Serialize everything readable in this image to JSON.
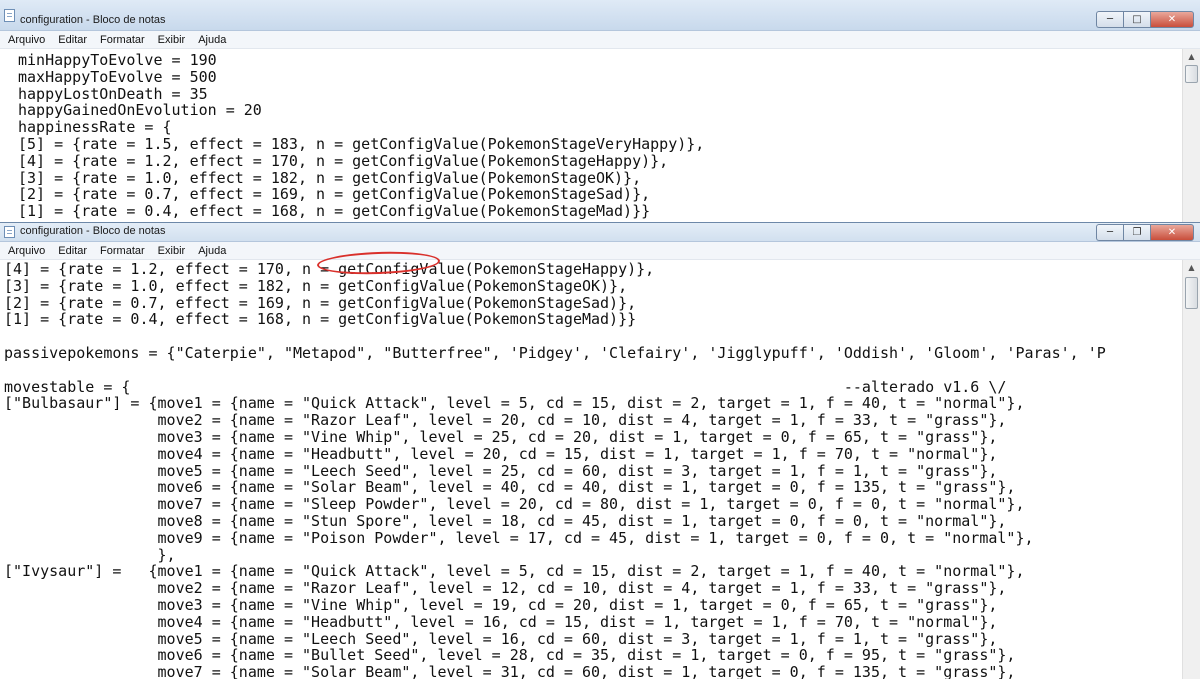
{
  "window_top": {
    "title": "configuration - Bloco de notas",
    "menu": [
      "Arquivo",
      "Editar",
      "Formatar",
      "Exibir",
      "Ajuda"
    ],
    "content": "minHappyToEvolve = 190\nmaxHappyToEvolve = 500\nhappyLostOnDeath = 35\nhappyGainedOnEvolution = 20\nhappinessRate = {\n[5] = {rate = 1.5, effect = 183, n = getConfigValue(PokemonStageVeryHappy)},\n[4] = {rate = 1.2, effect = 170, n = getConfigValue(PokemonStageHappy)},\n[3] = {rate = 1.0, effect = 182, n = getConfigValue(PokemonStageOK)},\n[2] = {rate = 0.7, effect = 169, n = getConfigValue(PokemonStageSad)},\n[1] = {rate = 0.4, effect = 168, n = getConfigValue(PokemonStageMad)}}"
  },
  "window_bottom": {
    "title": "configuration - Bloco de notas",
    "menu": [
      "Arquivo",
      "Editar",
      "Formatar",
      "Exibir",
      "Ajuda"
    ],
    "content": "[4] = {rate = 1.2, effect = 170, n = getConfigValue(PokemonStageHappy)},\n[3] = {rate = 1.0, effect = 182, n = getConfigValue(PokemonStageOK)},\n[2] = {rate = 0.7, effect = 169, n = getConfigValue(PokemonStageSad)},\n[1] = {rate = 0.4, effect = 168, n = getConfigValue(PokemonStageMad)}}\n\npassivepokemons = {\"Caterpie\", \"Metapod\", \"Butterfree\", 'Pidgey', 'Clefairy', 'Jigglypuff', 'Oddish', 'Gloom', 'Paras', 'P\n\nmovestable = {                                                                               --alterado v1.6 \\/\n[\"Bulbasaur\"] = {move1 = {name = \"Quick Attack\", level = 5, cd = 15, dist = 2, target = 1, f = 40, t = \"normal\"},\n                 move2 = {name = \"Razor Leaf\", level = 20, cd = 10, dist = 4, target = 1, f = 33, t = \"grass\"},\n                 move3 = {name = \"Vine Whip\", level = 25, cd = 20, dist = 1, target = 0, f = 65, t = \"grass\"},\n                 move4 = {name = \"Headbutt\", level = 20, cd = 15, dist = 1, target = 1, f = 70, t = \"normal\"},\n                 move5 = {name = \"Leech Seed\", level = 25, cd = 60, dist = 3, target = 1, f = 1, t = \"grass\"},\n                 move6 = {name = \"Solar Beam\", level = 40, cd = 40, dist = 1, target = 0, f = 135, t = \"grass\"},\n                 move7 = {name = \"Sleep Powder\", level = 20, cd = 80, dist = 1, target = 0, f = 0, t = \"normal\"},\n                 move8 = {name = \"Stun Spore\", level = 18, cd = 45, dist = 1, target = 0, f = 0, t = \"normal\"},\n                 move9 = {name = \"Poison Powder\", level = 17, cd = 45, dist = 1, target = 0, f = 0, t = \"normal\"},\n                 },\n[\"Ivysaur\"] =   {move1 = {name = \"Quick Attack\", level = 5, cd = 15, dist = 2, target = 1, f = 40, t = \"normal\"},\n                 move2 = {name = \"Razor Leaf\", level = 12, cd = 10, dist = 4, target = 1, f = 33, t = \"grass\"},\n                 move3 = {name = \"Vine Whip\", level = 19, cd = 20, dist = 1, target = 0, f = 65, t = \"grass\"},\n                 move4 = {name = \"Headbutt\", level = 16, cd = 15, dist = 1, target = 1, f = 70, t = \"normal\"},\n                 move5 = {name = \"Leech Seed\", level = 16, cd = 60, dist = 3, target = 1, f = 1, t = \"grass\"},\n                 move6 = {name = \"Bullet Seed\", level = 28, cd = 35, dist = 1, target = 0, f = 95, t = \"grass\"},\n                 move7 = {name = \"Solar Beam\", level = 31, cd = 60, dist = 1, target = 0, f = 135, t = \"grass\"},"
  },
  "controls": {
    "minimize": "─",
    "maximize": "□",
    "restore": "❐",
    "close": "✕"
  },
  "scroll": {
    "up": "▲"
  },
  "colors": {
    "annotation": "#d9302b",
    "titlebar": "#c8d9ec"
  }
}
